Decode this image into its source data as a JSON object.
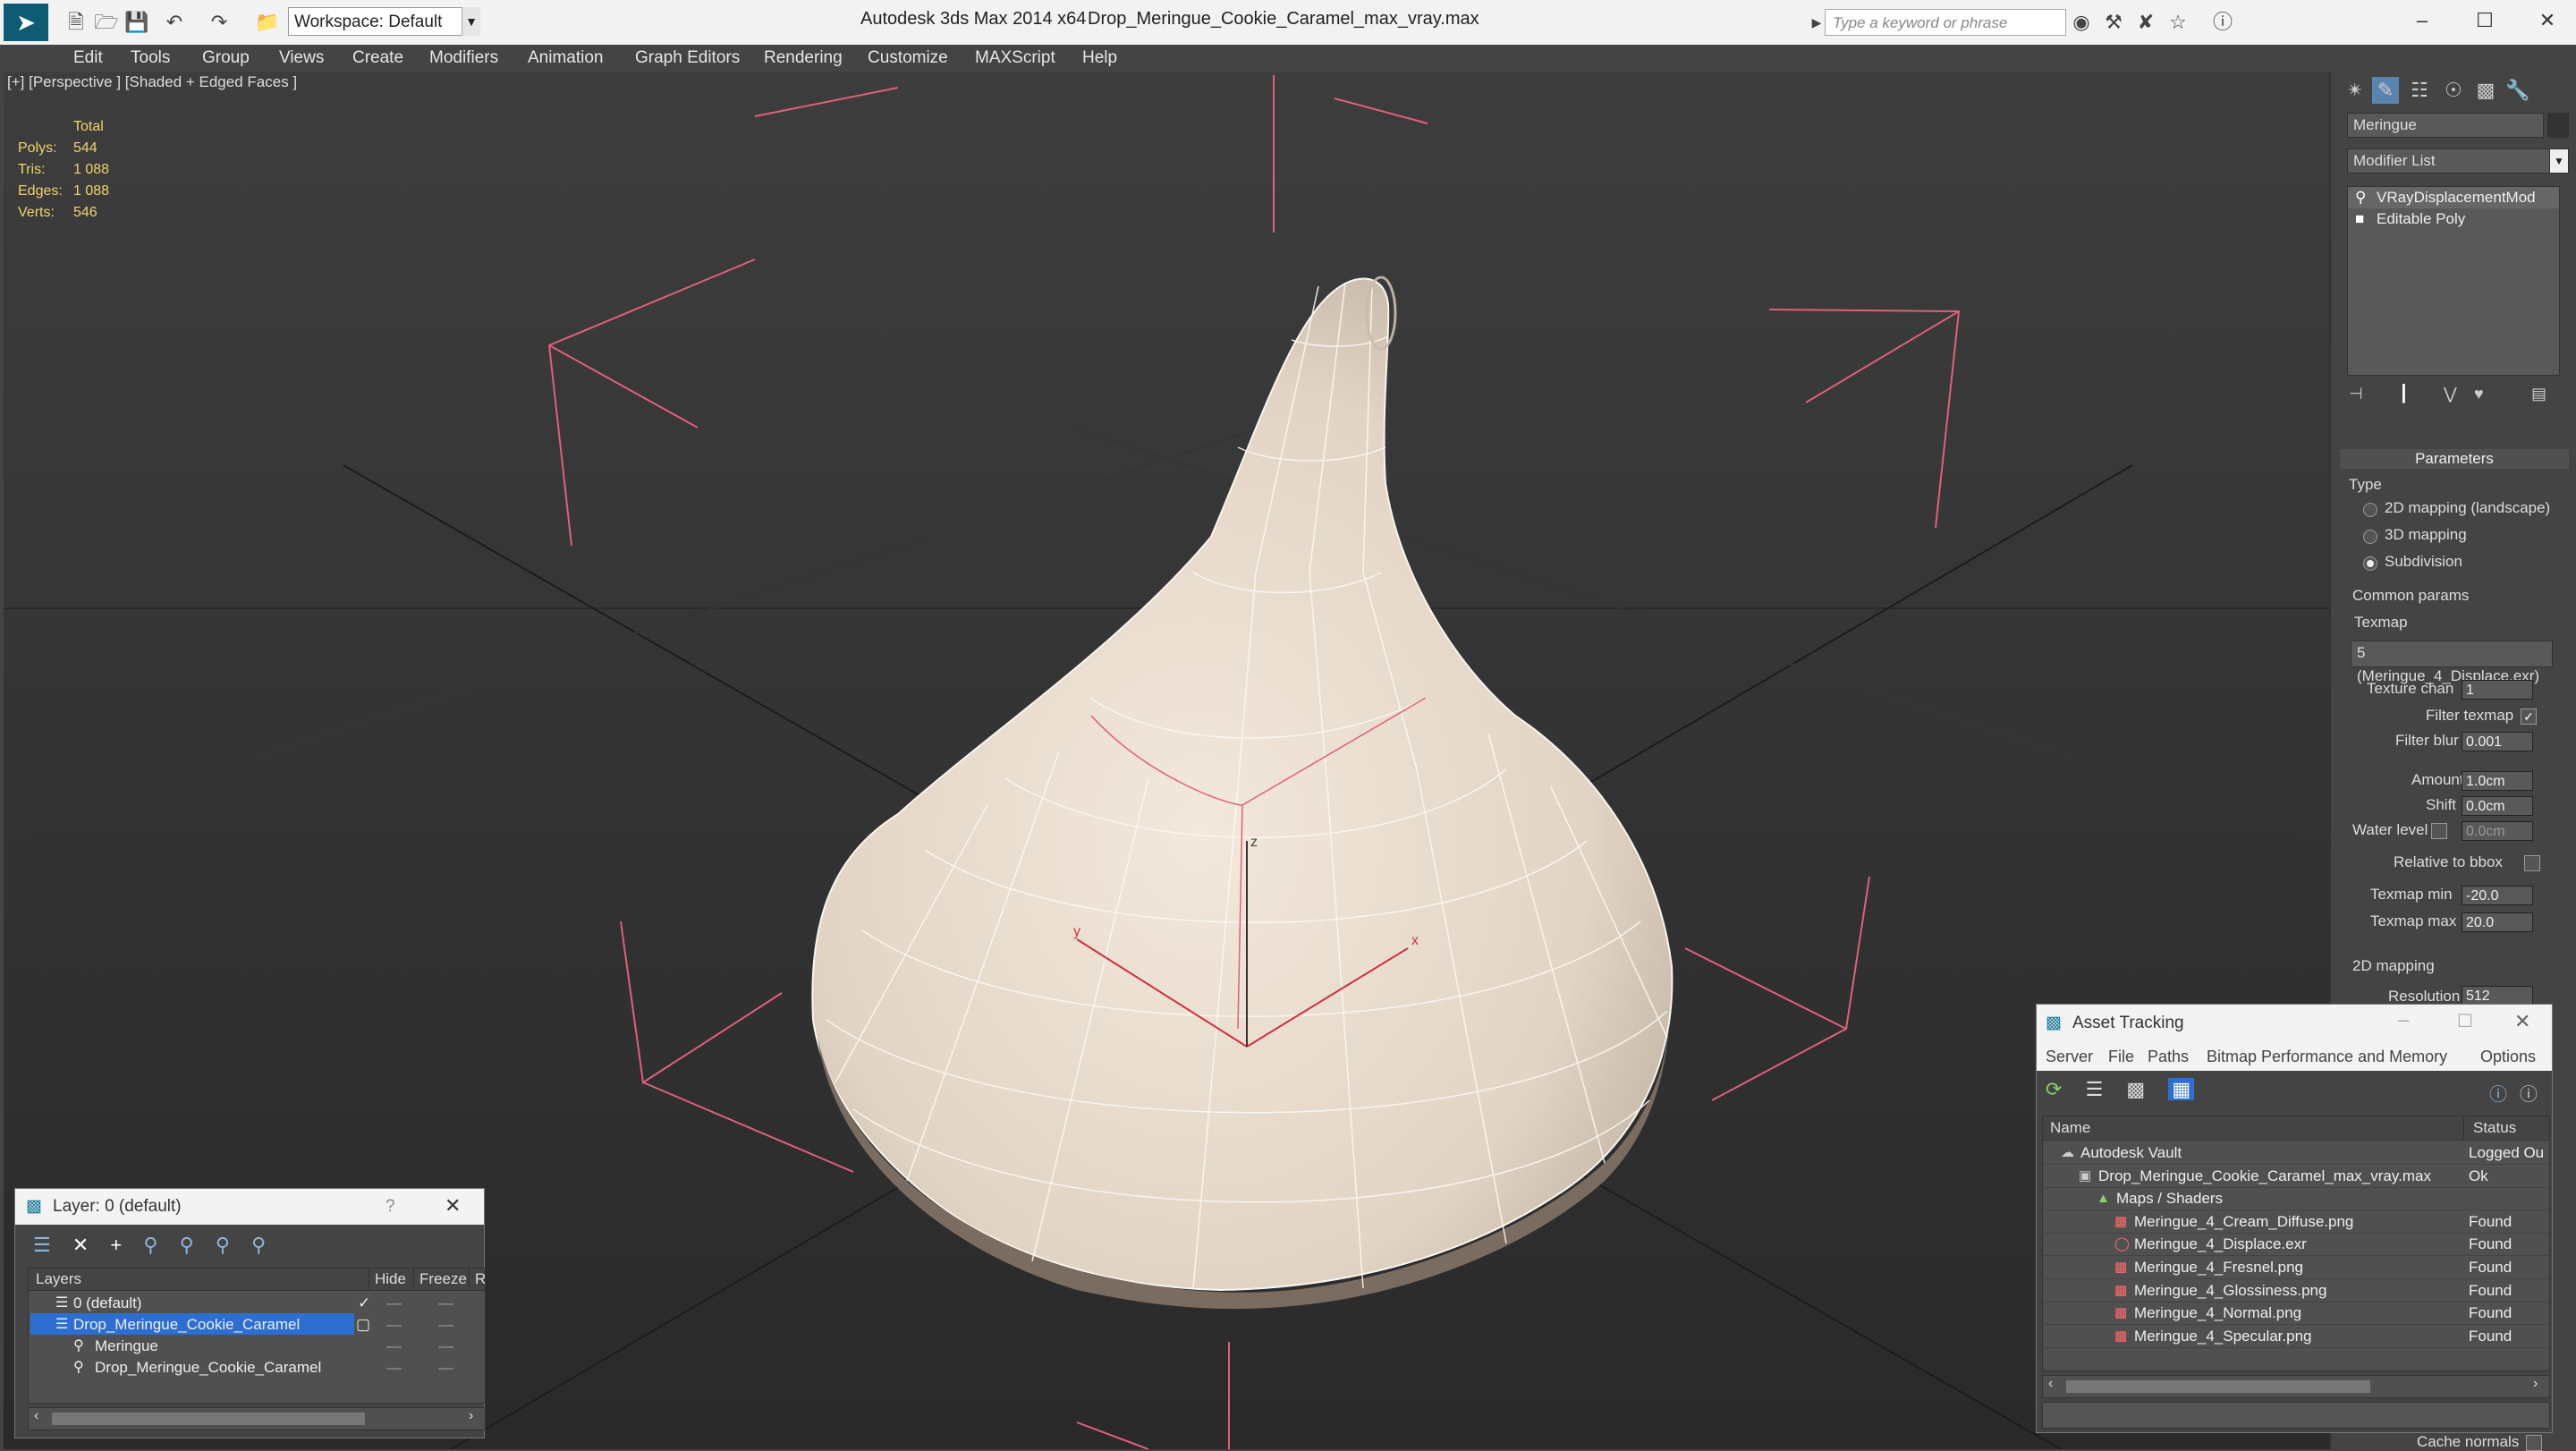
{
  "app": {
    "title": "Autodesk 3ds Max  2014 x64",
    "file": "Drop_Meringue_Cookie_Caramel_max_vray.max",
    "workspace": "Workspace: Default",
    "search_placeholder": "Type a keyword or phrase"
  },
  "menu": [
    "Edit",
    "Tools",
    "Group",
    "Views",
    "Create",
    "Modifiers",
    "Animation",
    "Graph Editors",
    "Rendering",
    "Customize",
    "MAXScript",
    "Help"
  ],
  "viewport": {
    "label": "[+] [Perspective ] [Shaded + Edged Faces ]",
    "stats": {
      "header": "Total",
      "polys_label": "Polys:",
      "polys": "544",
      "tris_label": "Tris:",
      "tris": "1 088",
      "edges_label": "Edges:",
      "edges": "1 088",
      "verts_label": "Verts:",
      "verts": "546"
    },
    "axes": {
      "x": "x",
      "y": "y",
      "z": "z"
    }
  },
  "command_panel": {
    "object_name": "Meringue",
    "modifier_list": "Modifier List",
    "stack": [
      "VRayDisplacementMod",
      "Editable Poly"
    ],
    "parameters_title": "Parameters",
    "type_label": "Type",
    "type_options": [
      "2D mapping (landscape)",
      "3D mapping",
      "Subdivision"
    ],
    "common_params": "Common params",
    "texmap_label": "Texmap",
    "texmap_value": "5 (Meringue_4_Displace.exr)",
    "texture_chan_label": "Texture chan",
    "texture_chan": "1",
    "filter_texmap_label": "Filter texmap",
    "filter_blur_label": "Filter blur",
    "filter_blur": "0.001",
    "amount_label": "Amount",
    "amount": "1.0cm",
    "shift_label": "Shift",
    "shift": "0.0cm",
    "water_level_label": "Water level",
    "water_level": "0.0cm",
    "relative_bbox_label": "Relative to bbox",
    "texmap_min_label": "Texmap min",
    "texmap_min": "-20.0",
    "texmap_max_label": "Texmap max",
    "texmap_max": "20.0",
    "mapping_2d": "2D mapping",
    "resolution_label": "Resolution",
    "resolution": "512",
    "cache_normals": "Cache normals"
  },
  "layer_panel": {
    "title": "Layer: 0 (default)",
    "help": "?",
    "columns": [
      "Layers",
      "Hide",
      "Freeze",
      "R"
    ],
    "rows": [
      {
        "name": "0 (default)",
        "indent": 0
      },
      {
        "name": "Drop_Meringue_Cookie_Caramel",
        "indent": 0,
        "selected": true
      },
      {
        "name": "Meringue",
        "indent": 1
      },
      {
        "name": "Drop_Meringue_Cookie_Caramel",
        "indent": 1
      }
    ]
  },
  "asset_panel": {
    "title": "Asset Tracking",
    "menu": [
      "Server",
      "File",
      "Paths",
      "Bitmap Performance and Memory",
      "Options"
    ],
    "columns": [
      "Name",
      "Status"
    ],
    "rows": [
      {
        "name": "Autodesk Vault",
        "status": "Logged Ou",
        "indent": 1
      },
      {
        "name": "Drop_Meringue_Cookie_Caramel_max_vray.max",
        "status": "Ok",
        "indent": 2
      },
      {
        "name": "Maps / Shaders",
        "status": "",
        "indent": 3
      },
      {
        "name": "Meringue_4_Cream_Diffuse.png",
        "status": "Found",
        "indent": 4
      },
      {
        "name": "Meringue_4_Displace.exr",
        "status": "Found",
        "indent": 4
      },
      {
        "name": "Meringue_4_Fresnel.png",
        "status": "Found",
        "indent": 4
      },
      {
        "name": "Meringue_4_Glossiness.png",
        "status": "Found",
        "indent": 4
      },
      {
        "name": "Meringue_4_Normal.png",
        "status": "Found",
        "indent": 4
      },
      {
        "name": "Meringue_4_Specular.png",
        "status": "Found",
        "indent": 4
      }
    ]
  },
  "colors": {
    "bracket": "#e0607a",
    "stats": "#f0d46a",
    "mesh": "#e6d9cb",
    "selection": "#2d6fd0"
  }
}
